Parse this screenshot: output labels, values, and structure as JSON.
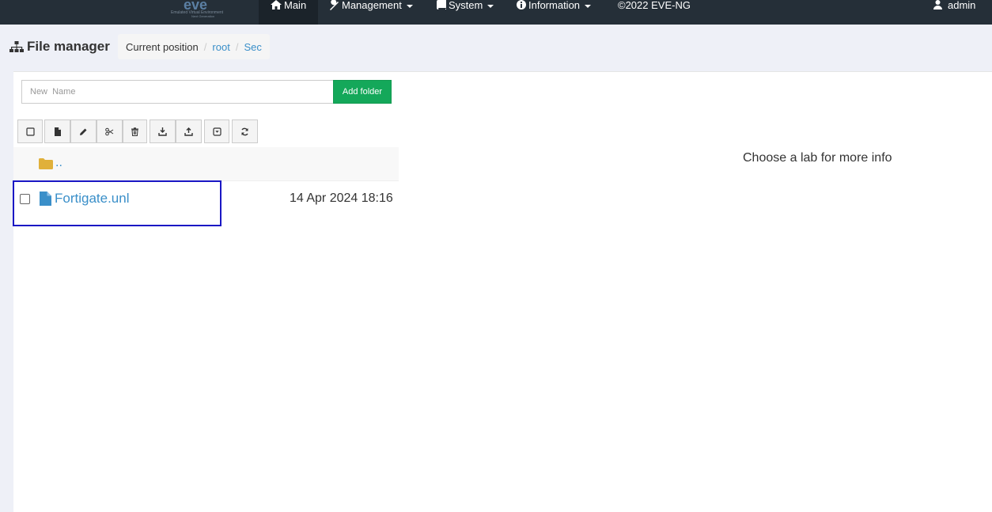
{
  "nav": {
    "items": [
      {
        "label": "Main",
        "icon": "home-icon"
      },
      {
        "label": "Management",
        "icon": "wrench-icon"
      },
      {
        "label": "System",
        "icon": "book-icon"
      },
      {
        "label": "Information",
        "icon": "info-icon"
      },
      {
        "label": "©2022 EVE-NG"
      }
    ],
    "user": "admin"
  },
  "header": {
    "title": "File manager",
    "breadcrumb_label": "Current position",
    "breadcrumb": [
      "root",
      "Sec"
    ]
  },
  "new_folder": {
    "placeholder": "New  Name",
    "button": "Add folder"
  },
  "toolbar": {
    "icons": [
      "select-all-icon",
      "new-file-icon",
      "edit-icon",
      "cut-icon",
      "delete-icon",
      "import-icon",
      "export-icon",
      "dropdown-icon",
      "refresh-icon"
    ]
  },
  "files": {
    "parent": "..",
    "items": [
      {
        "name": "Fortigate.unl",
        "date": "14 Apr 2024 18:16"
      }
    ]
  },
  "info_panel": {
    "text": "Choose a lab for more info"
  },
  "colors": {
    "navbar": "#252f38",
    "link": "#3a8fc9",
    "add_button": "#14a85a",
    "folder": "#e0b03a",
    "highlight": "#1a17c4"
  }
}
